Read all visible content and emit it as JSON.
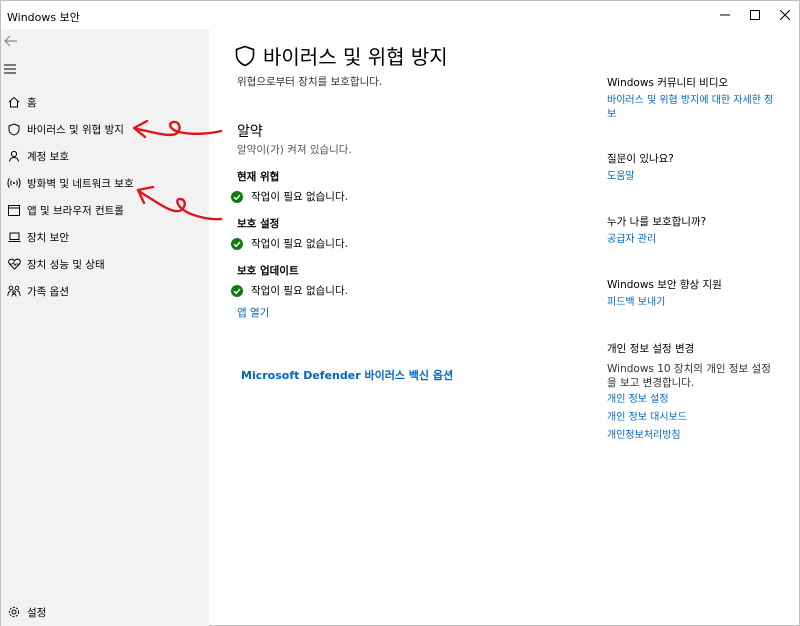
{
  "window": {
    "title": "Windows 보안",
    "min_glyph": "—",
    "max_glyph": "☐",
    "close_glyph": "✕"
  },
  "sidebar": {
    "back_icon": "back-arrow-icon",
    "menu_icon": "hamburger-menu-icon",
    "items": [
      {
        "label": "홈",
        "icon": "home-icon"
      },
      {
        "label": "바이러스 및 위협 방지",
        "icon": "shield-icon",
        "active": true
      },
      {
        "label": "계정 보호",
        "icon": "person-icon"
      },
      {
        "label": "방화벽 및 네트워크 보호",
        "icon": "wifi-antenna-icon"
      },
      {
        "label": "앱 및 브라우저 컨트롤",
        "icon": "browser-window-icon"
      },
      {
        "label": "장치 보안",
        "icon": "laptop-icon"
      },
      {
        "label": "장치 성능 및 상태",
        "icon": "heart-pulse-icon"
      },
      {
        "label": "가족 옵션",
        "icon": "family-icon"
      }
    ],
    "settings_label": "설정"
  },
  "main": {
    "title": "바이러스 및 위협 방지",
    "subtitle": "위협으로부터 장치를 보호합니다.",
    "alert_title": "알약",
    "alert_desc": "알약이(가) 켜져 있습니다.",
    "groups": [
      {
        "heading": "현재 위협",
        "status": "작업이 필요 없습니다."
      },
      {
        "heading": "보호 설정",
        "status": "작업이 필요 없습니다."
      },
      {
        "heading": "보호 업데이트",
        "status": "작업이 필요 없습니다."
      }
    ],
    "open_app_link": "앱 열기",
    "defender_link": "Microsoft Defender 바이러스 백신 옵션",
    "status_color": "#107c10",
    "link_color": "#0067c0"
  },
  "right": {
    "community": {
      "heading": "Windows 커뮤니티 비디오",
      "link": "바이러스 및 위협 방지에 대한 자세한 정보"
    },
    "question": {
      "heading": "질문이 있나요?",
      "link": "도움말"
    },
    "protector": {
      "heading": "누가 나를 보호합니까?",
      "link": "공급자 관리"
    },
    "improve": {
      "heading": "Windows 보안 향상 지원",
      "link": "피드백 보내기"
    },
    "privacy": {
      "heading": "개인 정보 설정 변경",
      "text": "Windows 10 장치의 개인 정보 설정을 보고 변경합니다.",
      "links": [
        "개인 정보 설정",
        "개인 정보 대시보드",
        "개인정보처리방침"
      ]
    }
  },
  "annotation_color": "#e0161d"
}
